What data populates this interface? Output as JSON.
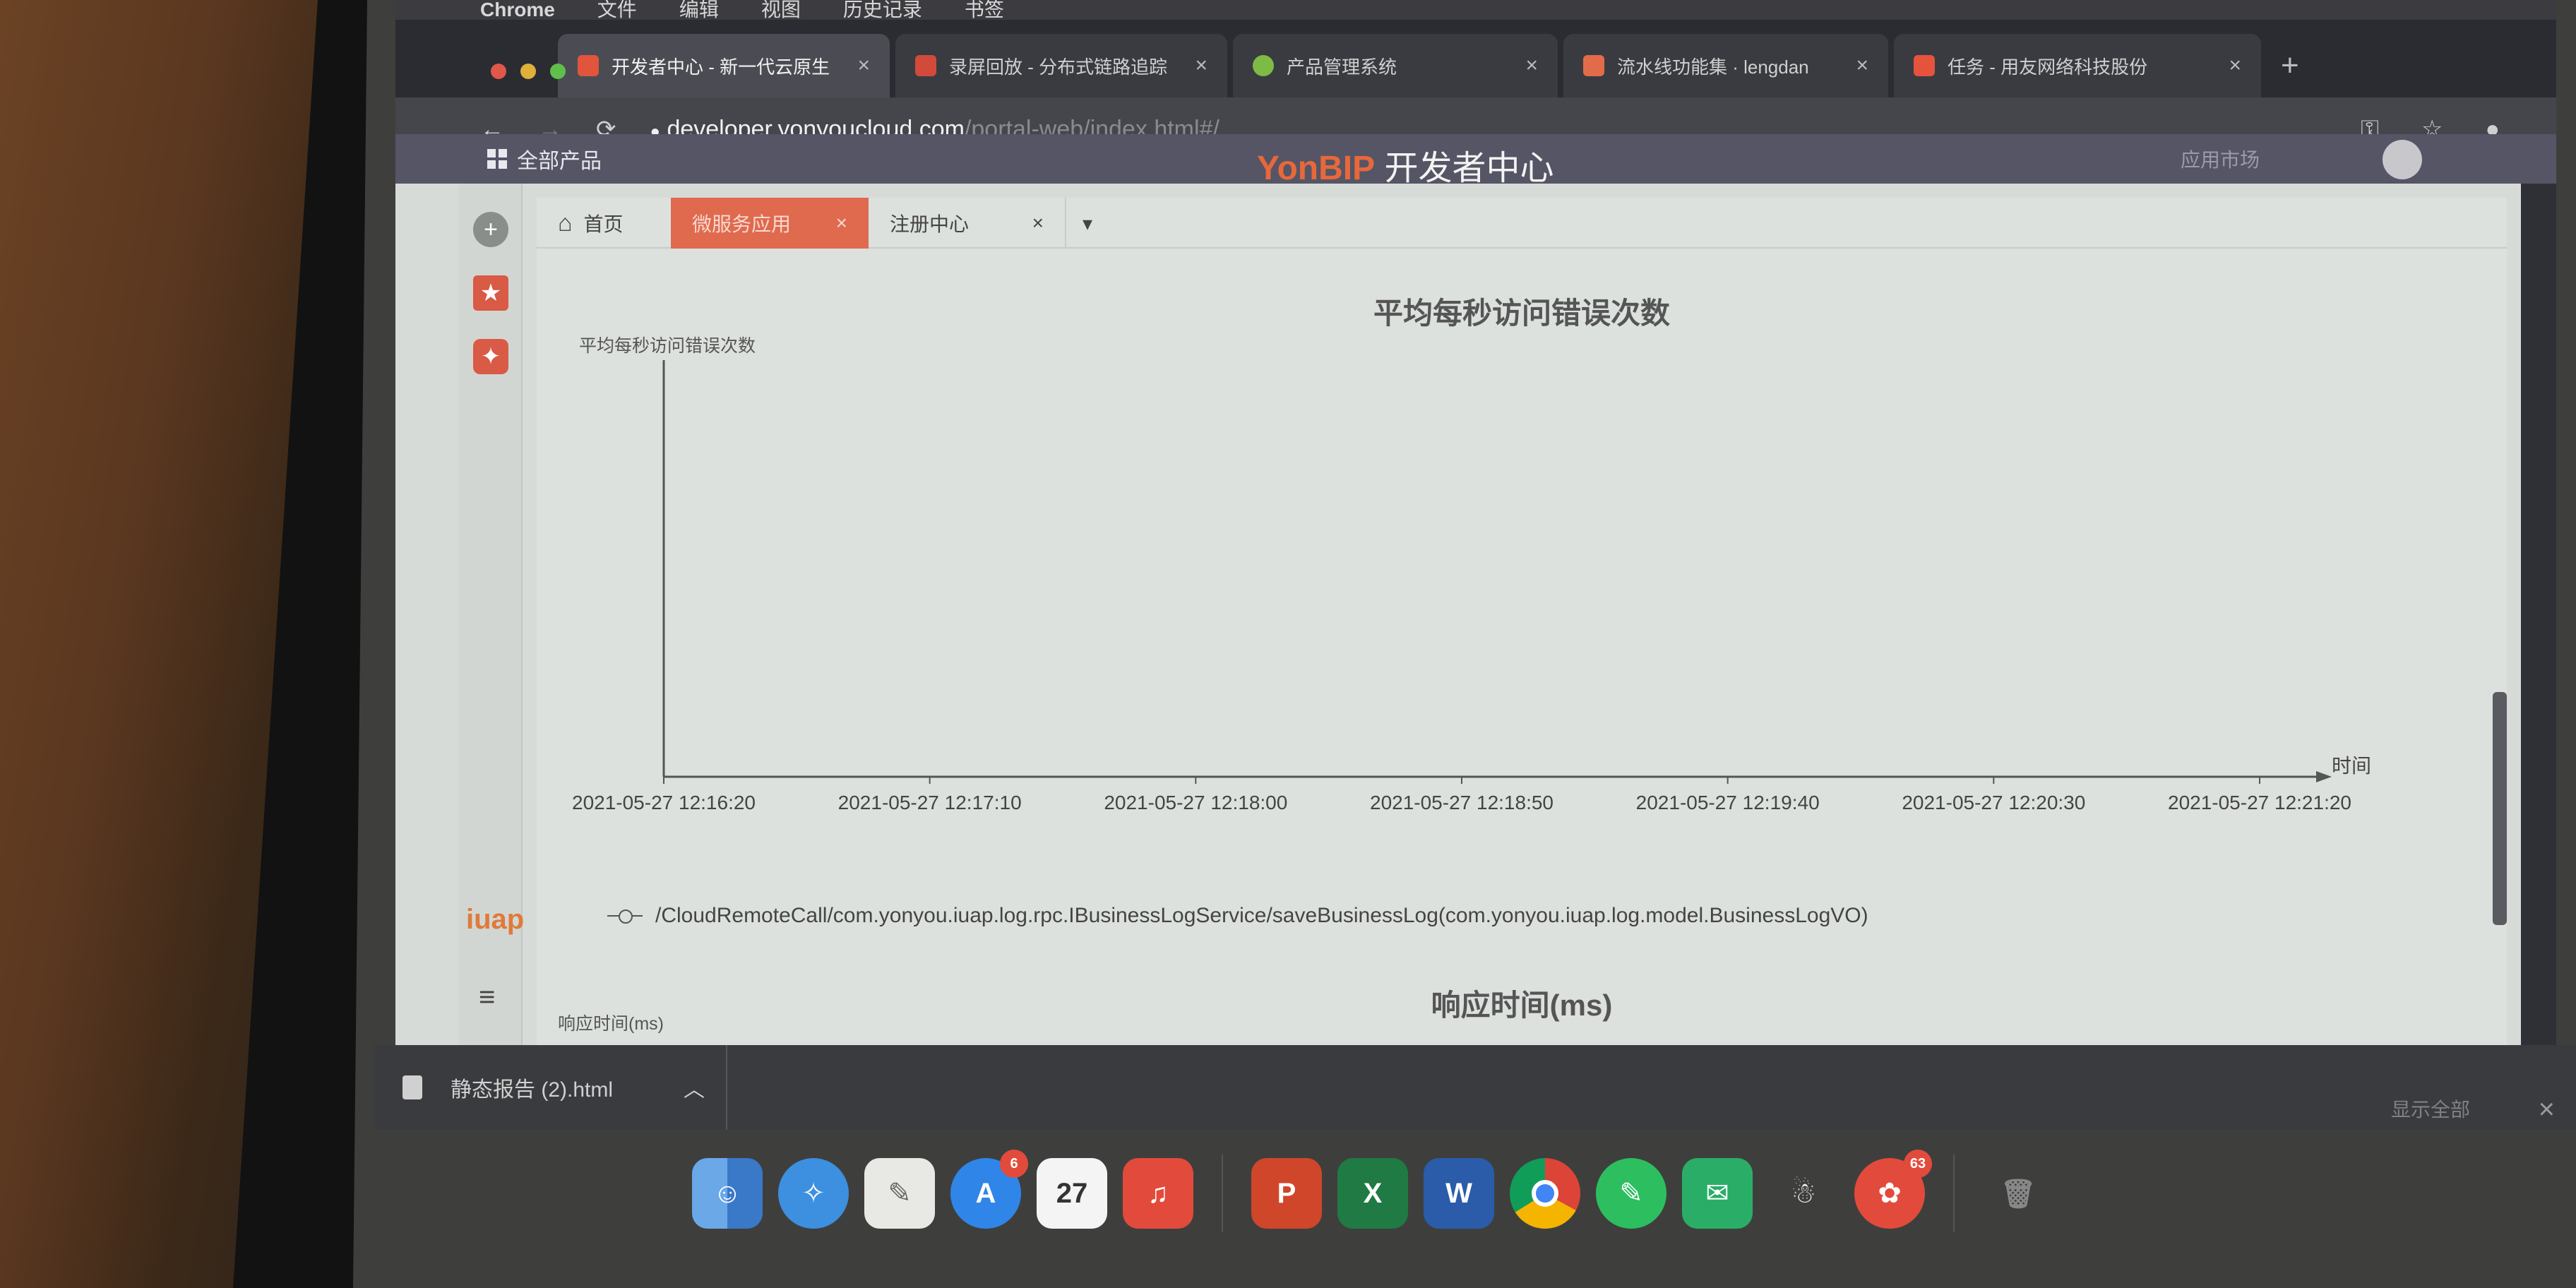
{
  "macos": {
    "menubar": [
      "Chrome",
      "文件",
      "编辑",
      "视图",
      "历史记录",
      "书签"
    ]
  },
  "browser": {
    "tabs": [
      {
        "label": "开发者中心 - 新一代云原生",
        "active": true
      },
      {
        "label": "录屏回放 - 分布式链路追踪",
        "active": false
      },
      {
        "label": "产品管理系统",
        "active": false
      },
      {
        "label": "流水线功能集 · lengdan",
        "active": false
      },
      {
        "label": "任务 - 用友网络科技股份",
        "active": false
      }
    ],
    "url_host": "developer.yonyoucloud.com",
    "url_path": "/portal-web/index.html#/"
  },
  "app": {
    "all_products": "全部产品",
    "brand_prefix": "YonBIP",
    "brand_suffix": "开发者中心",
    "market": "应用市场",
    "rail_logo": "iuap",
    "page_tabs": {
      "home": "首页",
      "micro": "微服务应用",
      "registry": "注册中心"
    }
  },
  "chart_data": [
    {
      "type": "line",
      "title": "平均每秒访问错误次数",
      "ylabel": "平均每秒访问错误次数",
      "xlabel": "时间",
      "x": [
        "2021-05-27 12:16:20",
        "2021-05-27 12:17:10",
        "2021-05-27 12:18:00",
        "2021-05-27 12:18:50",
        "2021-05-27 12:19:40",
        "2021-05-27 12:20:30",
        "2021-05-27 12:21:20"
      ],
      "series": [
        {
          "name": "/CloudRemoteCall/com.yonyou.iuap.log.rpc.IBusinessLogService/saveBusinessLog(com.yonyou.iuap.log.model.BusinessLogVO)",
          "values": []
        }
      ],
      "legend": "bottom-left",
      "grid": false
    },
    {
      "type": "line",
      "title": "响应时间(ms)",
      "ylabel": "响应时间(ms)"
    }
  ],
  "download": {
    "file": "静态报告 (2).html",
    "show_all": "显示全部"
  },
  "dock": {
    "calendar_day": "27",
    "appstore_badge": "6",
    "last_badge": "63"
  },
  "colors": {
    "accent": "#e06a4e",
    "brand_orange": "#e7683a",
    "header_bg": "#555566",
    "page_bg": "#dde1de"
  }
}
